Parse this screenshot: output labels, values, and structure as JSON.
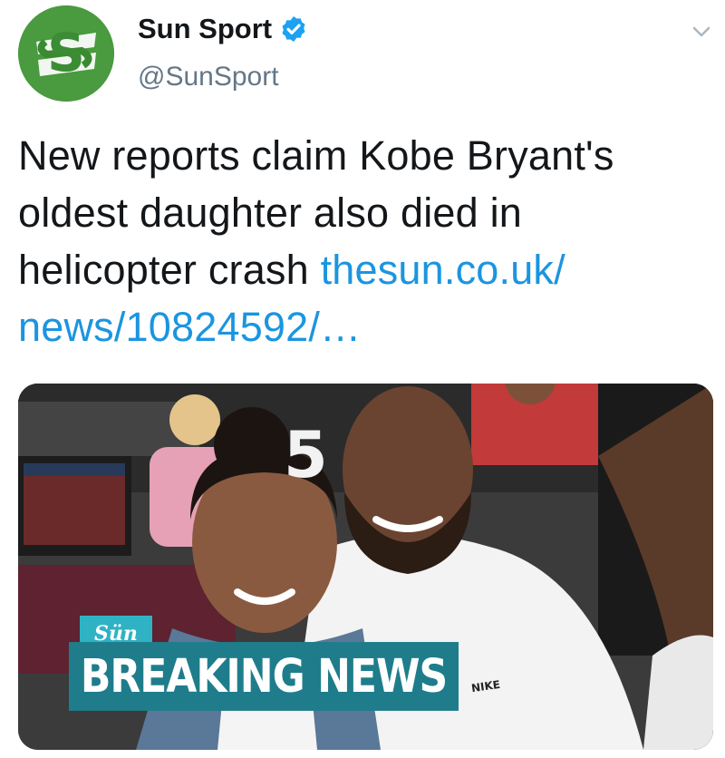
{
  "account": {
    "display_name": "Sun Sport",
    "handle": "@SunSport",
    "avatar_letter": "S",
    "verified": true
  },
  "tweet": {
    "text": "New reports claim Kobe Bryant's oldest daughter also died in helicopter crash ",
    "link_text": "thesun.co.uk/ news/10824592/…"
  },
  "media": {
    "jersey_number": "5",
    "logo_text": "Sün",
    "banner_text": "BREAKING NEWS",
    "shirt_logo_text": "NIKE"
  },
  "colors": {
    "link": "#1b95e0",
    "verified": "#1da1f2",
    "banner": "#1f7d8b",
    "logo_bg": "#2fb3c4"
  },
  "icons": {
    "verified": "verified-badge-icon",
    "menu": "chevron-down-icon"
  }
}
